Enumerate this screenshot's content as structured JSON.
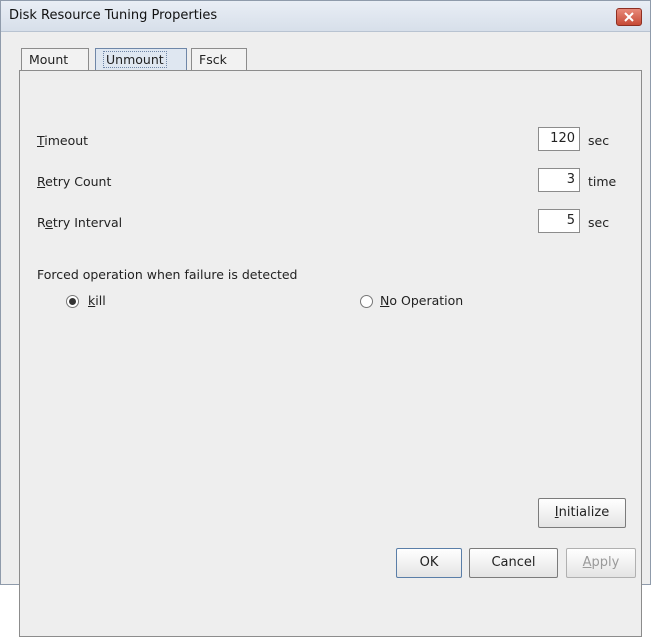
{
  "window": {
    "title": "Disk Resource Tuning Properties"
  },
  "tabs": [
    {
      "label": "Mount"
    },
    {
      "label": "Unmount"
    },
    {
      "label": "Fsck"
    }
  ],
  "unmount": {
    "timeout": {
      "label_first": "T",
      "label_rest": "imeout",
      "value": "120",
      "unit": "sec"
    },
    "retry_count": {
      "label_first": "R",
      "label_rest": "etry Count",
      "value": "3",
      "unit": "time"
    },
    "retry_interval": {
      "label_first": "R",
      "label_mid": "e",
      "label_rest": "try Interval",
      "value": "5",
      "unit": "sec"
    },
    "forced_operation_label": "Forced operation when failure is detected",
    "options": [
      {
        "label_first": "k",
        "label_rest": "ill",
        "checked": true
      },
      {
        "label_first": "N",
        "label_rest": "o Operation",
        "checked": false
      }
    ],
    "initialize_first": "I",
    "initialize_rest": "nitialize"
  },
  "footer": {
    "ok": "OK",
    "cancel": "Cancel",
    "apply_first": "A",
    "apply_rest": "pply"
  }
}
